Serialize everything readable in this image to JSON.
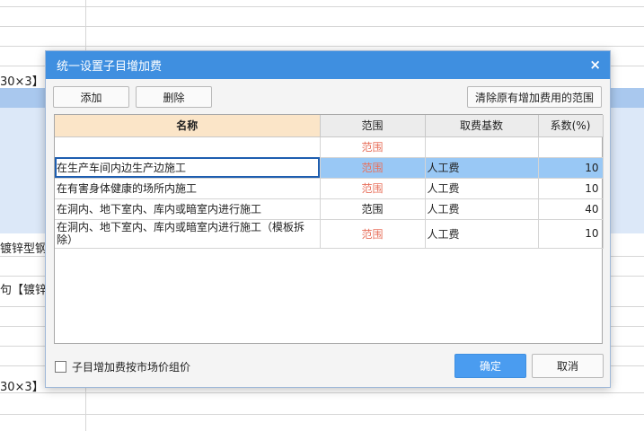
{
  "background": {
    "text_rows": [
      "30×3】",
      "镀锌型钢",
      "句【镀锌",
      "30×3】"
    ]
  },
  "dialog": {
    "title": "统一设置子目增加费",
    "close_glyph": "×",
    "toolbar": {
      "add_label": "添加",
      "delete_label": "删除",
      "clear_label": "清除原有增加费用的范围"
    },
    "table": {
      "headers": [
        "名称",
        "范围",
        "取费基数",
        "系数(%)"
      ],
      "rows": [
        {
          "name": "",
          "range": "范围",
          "base": "",
          "coef": ""
        },
        {
          "name": "在生产车间内边生产边施工",
          "range": "范围",
          "base": "人工费",
          "coef": "10"
        },
        {
          "name": "在有害身体健康的场所内施工",
          "range": "范围",
          "base": "人工费",
          "coef": "10"
        },
        {
          "name": "在洞内、地下室内、库内或暗室内进行施工",
          "range": "范围",
          "base": "人工费",
          "coef": "40"
        },
        {
          "name": "在洞内、地下室内、库内或暗室内进行施工（模板拆除）",
          "range": "范围",
          "base": "人工费",
          "coef": "10"
        }
      ]
    },
    "market_price_label": "子目增加费按市场价组价",
    "ok_label": "确定",
    "cancel_label": "取消"
  },
  "colors": {
    "title_bar": "#3f8fe0",
    "range_link": "#e8715d",
    "selected_row": "#99c8f5",
    "name_header": "#fbe5c8",
    "ok_button": "#4a9cf0"
  }
}
